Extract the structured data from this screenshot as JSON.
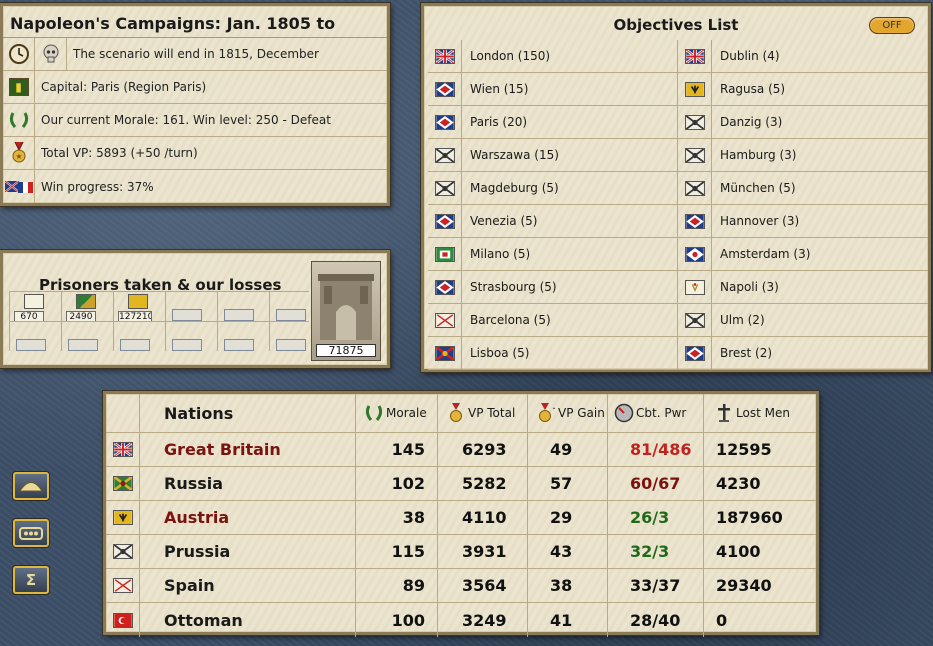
{
  "scenario": {
    "title": "Napoleon's Campaigns: Jan. 1805 to",
    "end_text": "The scenario will end in 1815, December",
    "capital": "Capital: Paris (Region Paris)",
    "morale": "Our current Morale: 161. Win level: 250 - Defeat",
    "vp": "Total VP: 5893 (+50 /turn)",
    "progress": "Win progress: 37%",
    "icons": [
      "clock-icon",
      "skull-icon",
      "capital-flag-icon",
      "laurel-icon",
      "medal-icon",
      "win-flags-icon"
    ]
  },
  "prisoners": {
    "title": "Prisoners taken & our losses",
    "taken": [
      {
        "value": "670",
        "flag": "naples"
      },
      {
        "value": "2490",
        "flag": "russia"
      },
      {
        "value": "127210",
        "flag": "austria"
      }
    ],
    "our_losses": "71875"
  },
  "objectives": {
    "title": "Objectives List",
    "toggle": "OFF",
    "rows": [
      [
        {
          "name": "London (150)",
          "flag": "gb"
        },
        {
          "name": "Dublin (4)",
          "flag": "gb"
        }
      ],
      [
        {
          "name": "Wien (15)",
          "flag": "fr"
        },
        {
          "name": "Ragusa (5)",
          "flag": "austria"
        }
      ],
      [
        {
          "name": "Paris (20)",
          "flag": "fr"
        },
        {
          "name": "Danzig (3)",
          "flag": "prussia"
        }
      ],
      [
        {
          "name": "Warszawa (15)",
          "flag": "prussia"
        },
        {
          "name": "Hamburg (3)",
          "flag": "prussia"
        }
      ],
      [
        {
          "name": "Magdeburg (5)",
          "flag": "prussia"
        },
        {
          "name": "München (5)",
          "flag": "prussia"
        }
      ],
      [
        {
          "name": "Venezia (5)",
          "flag": "fr"
        },
        {
          "name": "Hannover (3)",
          "flag": "fr"
        }
      ],
      [
        {
          "name": "Milano (5)",
          "flag": "italy"
        },
        {
          "name": "Amsterdam (3)",
          "flag": "holland"
        }
      ],
      [
        {
          "name": "Strasbourg (5)",
          "flag": "fr"
        },
        {
          "name": "Napoli (3)",
          "flag": "naples"
        }
      ],
      [
        {
          "name": "Barcelona (5)",
          "flag": "spain"
        },
        {
          "name": "Ulm (2)",
          "flag": "prussia"
        }
      ],
      [
        {
          "name": "Lisboa (5)",
          "flag": "portugal"
        },
        {
          "name": "Brest (2)",
          "flag": "fr"
        }
      ]
    ]
  },
  "nations": {
    "headers": {
      "name": "Nations",
      "morale": "Morale",
      "vp_total": "VP Total",
      "vp_gain": "VP Gain",
      "cbt_pwr": "Cbt. Pwr",
      "lost_men": "Lost Men"
    },
    "rows": [
      {
        "flag": "gb",
        "name": "Great Britain",
        "name_color": "#7a1210",
        "morale": "145",
        "vp_total": "6293",
        "vp_gain": "49",
        "cbt": "81/486",
        "cbt_color": "#c0221d",
        "lost": "12595"
      },
      {
        "flag": "russia",
        "name": "Russia",
        "name_color": "#1a1a1a",
        "morale": "102",
        "vp_total": "5282",
        "vp_gain": "57",
        "cbt": "60/67",
        "cbt_color": "#7a1210",
        "lost": "4230"
      },
      {
        "flag": "austria",
        "name": "Austria",
        "name_color": "#7a1210",
        "morale": "38",
        "vp_total": "4110",
        "vp_gain": "29",
        "cbt": "26/3",
        "cbt_color": "#1f6a18",
        "lost": "187960"
      },
      {
        "flag": "prussia",
        "name": "Prussia",
        "name_color": "#1a1a1a",
        "morale": "115",
        "vp_total": "3931",
        "vp_gain": "43",
        "cbt": "32/3",
        "cbt_color": "#1f6a18",
        "lost": "4100"
      },
      {
        "flag": "spain",
        "name": "Spain",
        "name_color": "#1a1a1a",
        "morale": "89",
        "vp_total": "3564",
        "vp_gain": "38",
        "cbt": "33/37",
        "cbt_color": "#111111",
        "lost": "29340"
      },
      {
        "flag": "ottoman",
        "name": "Ottoman",
        "name_color": "#1a1a1a",
        "morale": "100",
        "vp_total": "3249",
        "vp_gain": "41",
        "cbt": "28/40",
        "cbt_color": "#111111",
        "lost": "0"
      }
    ]
  },
  "side_buttons": [
    {
      "name": "hat-button",
      "icon": "bicorne-hat-icon"
    },
    {
      "name": "army-button",
      "icon": "army-group-icon"
    },
    {
      "name": "sum-button",
      "icon": "sigma-icon",
      "glyph": "Σ"
    }
  ]
}
